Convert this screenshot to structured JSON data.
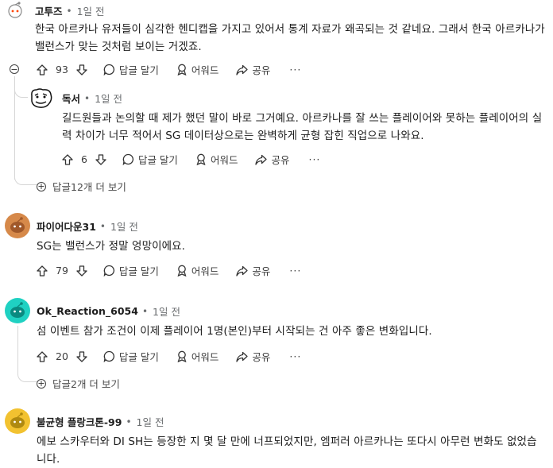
{
  "comments": [
    {
      "username": "고투즈",
      "time": "1일 전",
      "text": "한국 아르카나 유저들이 심각한 헨디캡을 가지고 있어서 통계 자료가 왜곡되는 것 같네요. 그래서 한국 아르카나가 밸런스가 맞는 것처럼 보이는 거겠죠.",
      "votes": "93",
      "reply_label": "답글 달기",
      "award_label": "어워드",
      "share_label": "공유",
      "more_label": "···",
      "reply": {
        "username": "독서",
        "time": "1일 전",
        "text": "길드원들과 논의할 때 제가 했던 말이 바로 그거예요. 아르카나를 잘 쓰는 플레이어와 못하는 플레이어의 실력 차이가 너무 적어서 SG 데이터상으로는 완벽하게 균형 잡힌 직업으로 나와요.",
        "votes": "6",
        "reply_label": "답글 달기",
        "award_label": "어워드",
        "share_label": "공유",
        "more_label": "···"
      },
      "more_replies": "답글12개 더 보기"
    },
    {
      "username": "파이어다운31",
      "time": "1일 전",
      "text": "SG는 밸런스가 정말 엉망이에요.",
      "votes": "79",
      "reply_label": "답글 달기",
      "award_label": "어워드",
      "share_label": "공유",
      "more_label": "···"
    },
    {
      "username": "Ok_Reaction_6054",
      "time": "1일 전",
      "text": "섬 이벤트 참가 조건이 이제 플레이어 1명(본인)부터 시작되는 건 아주 좋은 변화입니다.",
      "votes": "20",
      "reply_label": "답글 달기",
      "award_label": "어워드",
      "share_label": "공유",
      "more_label": "···",
      "more_replies": "답글2개 더 보기"
    },
    {
      "username": "불균형 플랑크톤-99",
      "time": "1일 전",
      "text": "에보 스카우터와 DI SH는 등장한 지 몇 달 만에 너프되었지만, 엠퍼러 아르카나는 또다시 아무런 변화도 없었습니다."
    }
  ],
  "colors": {
    "avatar_orange": "#d6894a",
    "avatar_teal": "#1fd1c2",
    "avatar_yellow": "#f2c230",
    "thread_line": "#d6d6d6"
  }
}
